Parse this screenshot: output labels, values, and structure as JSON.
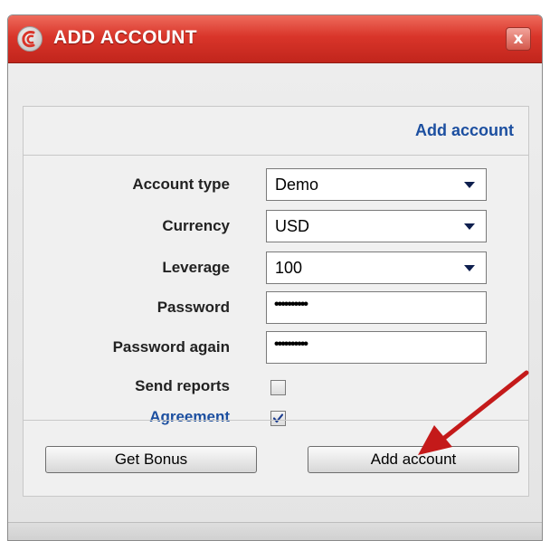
{
  "window": {
    "title": "ADD ACCOUNT",
    "close_label": "x"
  },
  "panel": {
    "header_link": "Add account"
  },
  "form": {
    "account_type": {
      "label": "Account type",
      "value": "Demo"
    },
    "currency": {
      "label": "Currency",
      "value": "USD"
    },
    "leverage": {
      "label": "Leverage",
      "value": "100"
    },
    "password": {
      "label": "Password",
      "masked_value": "••••••••••"
    },
    "password_again": {
      "label": "Password again",
      "masked_value": "••••••••••"
    },
    "send_reports": {
      "label": "Send reports",
      "checked": false
    },
    "agreement": {
      "label": "Agreement",
      "checked": true
    }
  },
  "buttons": {
    "get_bonus": "Get Bonus",
    "add_account": "Add account"
  },
  "colors": {
    "title_bar": "#d9352a",
    "link_blue": "#1c4fa0",
    "annotation_arrow": "#c41a1a"
  },
  "icons": {
    "title_logo": "app-logo-icon",
    "close": "close-icon",
    "dropdown": "chevron-down-icon",
    "check": "checkmark-icon",
    "annotation": "red-arrow-annotation"
  }
}
